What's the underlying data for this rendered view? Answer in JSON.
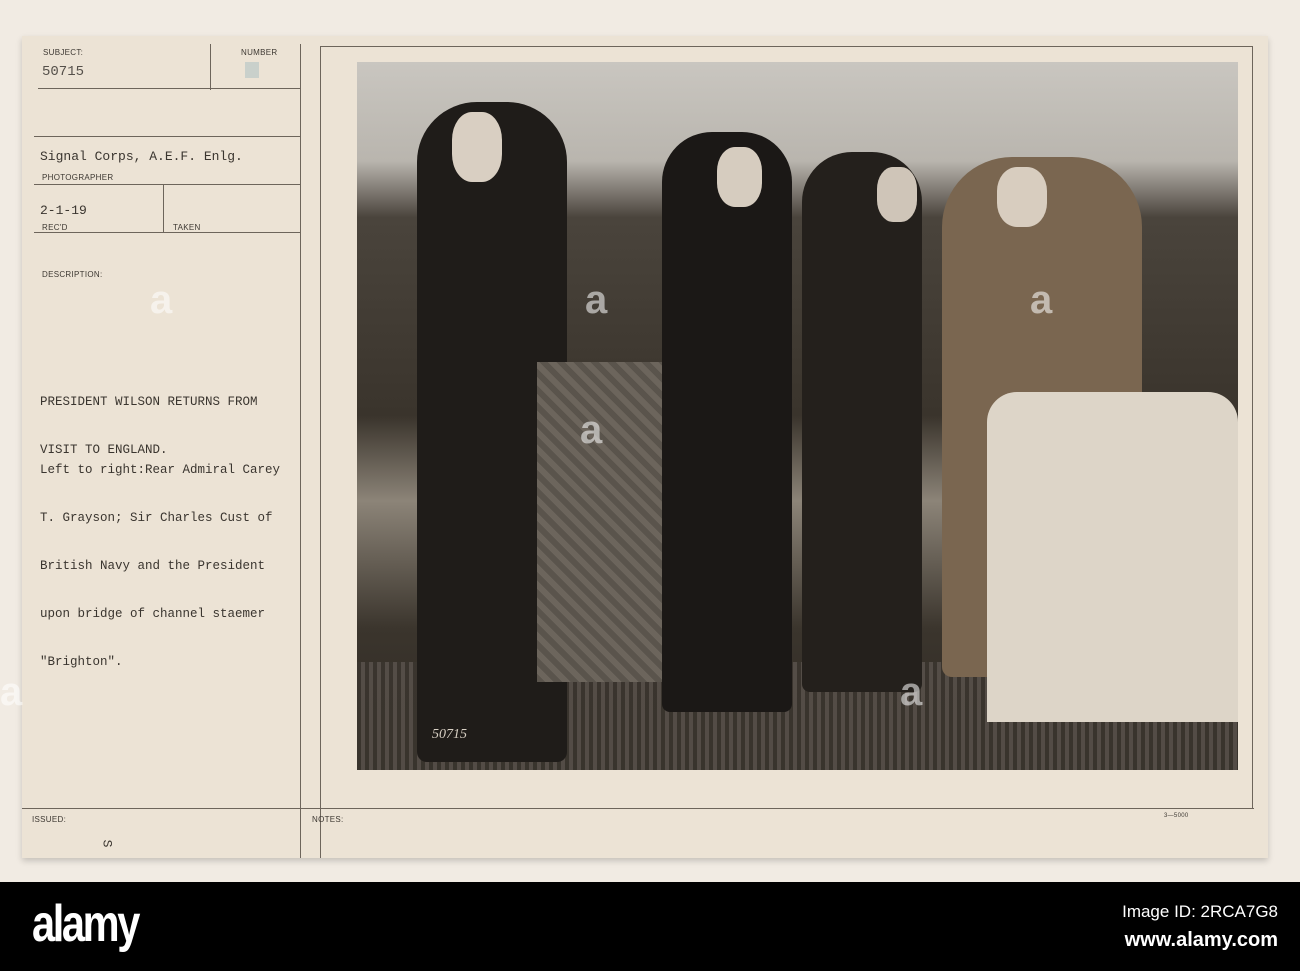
{
  "card": {
    "subject_label": "SUBJECT:",
    "subject_value": "50715",
    "number_label": "NUMBER",
    "photographer_value": "Signal Corps, A.E.F. Enlg.",
    "photographer_label": "PHOTOGRAPHER",
    "recd_value": "2-1-19",
    "recd_label": "REC'D",
    "taken_label": "TAKEN",
    "description_label": "DESCRIPTION:",
    "title_lines": [
      "PRESIDENT WILSON RETURNS FROM",
      "VISIT TO ENGLAND."
    ],
    "caption_lines": [
      "Left to right:Rear Admiral Carey",
      "T. Grayson; Sir Charles Cust of",
      "British Navy and the President",
      "upon bridge of channel staemer",
      "\"Brighton\"."
    ],
    "issued_label": "ISSUED:",
    "issued_value": "S",
    "notes_label": "NOTES:",
    "form_code": "3—5000",
    "photo_stamp_number": "50715"
  },
  "footer": {
    "logo": "alamy",
    "image_id": "Image ID: 2RCA7G8",
    "url": "www.alamy.com"
  }
}
